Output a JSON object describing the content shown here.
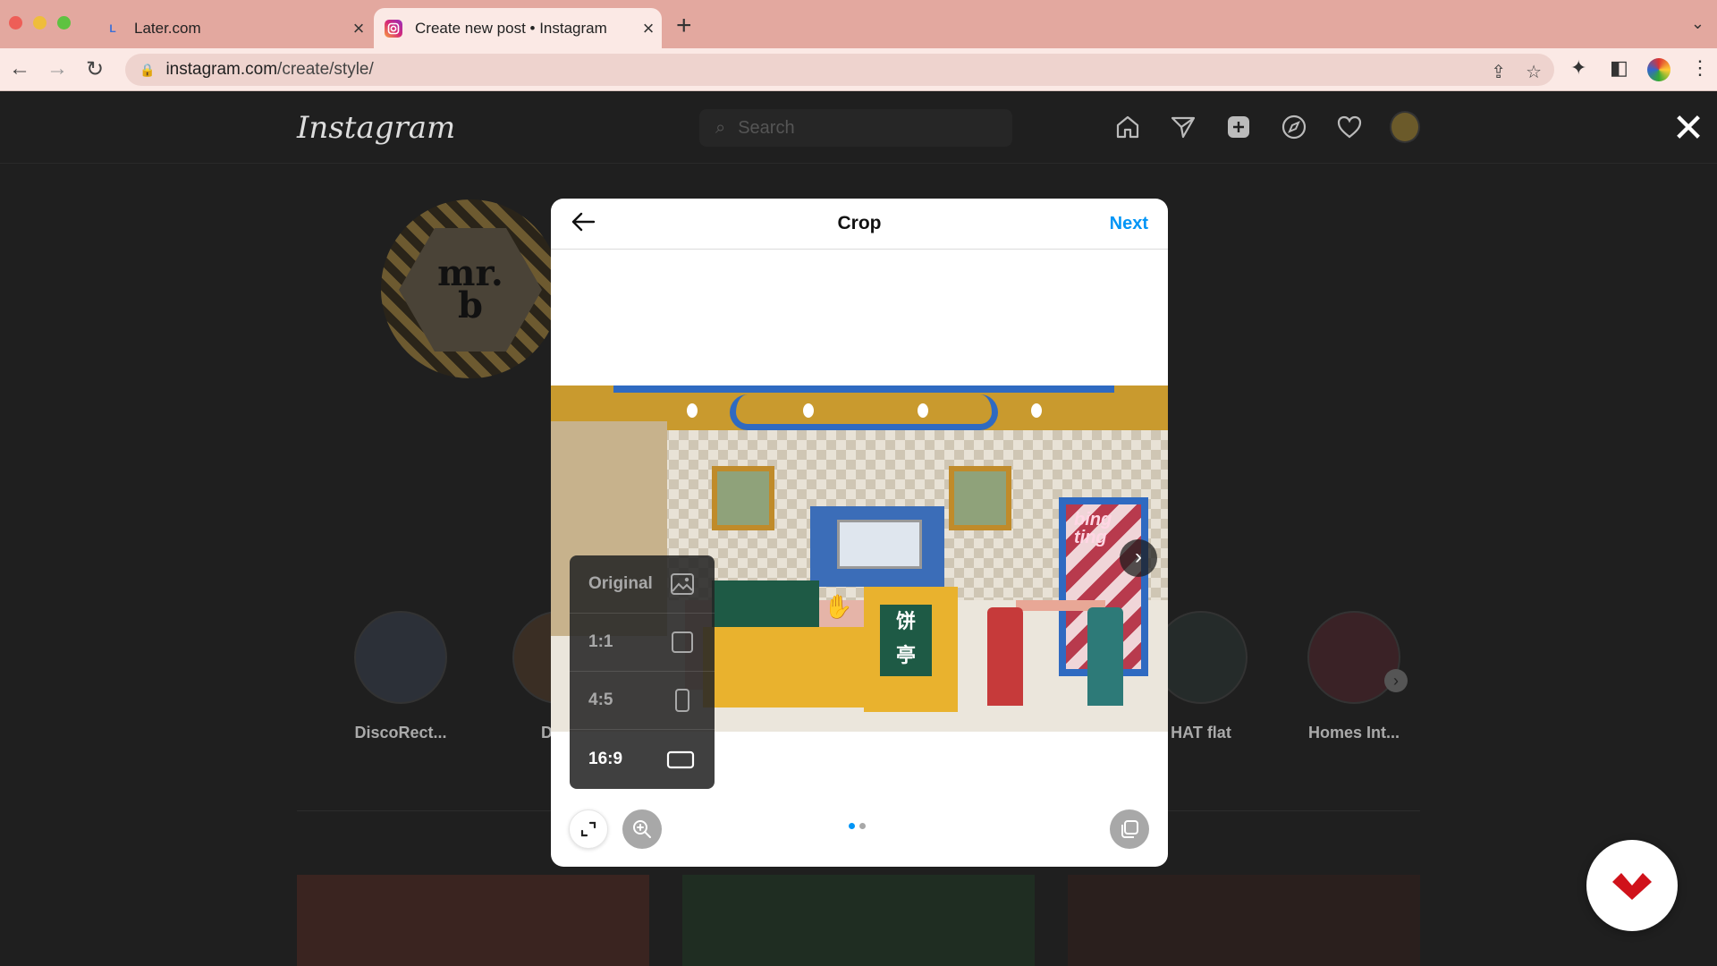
{
  "browser": {
    "tabs": [
      {
        "title": "Later.com",
        "favicon": "later-logo-icon",
        "active": false
      },
      {
        "title": "Create new post • Instagram",
        "favicon": "instagram-icon",
        "active": true
      }
    ],
    "url_host": "instagram.com",
    "url_path": "/create/style/",
    "colors": {
      "tabbar": "#e3a89f",
      "toolbar": "#fbe9e5"
    }
  },
  "instagram": {
    "logo": "Instagram",
    "search_placeholder": "Search",
    "nav_icons": [
      "home-icon",
      "direct-icon",
      "new-post-icon",
      "explore-icon",
      "activity-heart-icon",
      "profile-avatar"
    ],
    "profile_badge": "mr.\nb",
    "highlights": [
      {
        "label": "DiscoRect..."
      },
      {
        "label": "Drea"
      },
      {
        "label": "HAT flat"
      },
      {
        "label": "Homes Int..."
      }
    ]
  },
  "modal": {
    "title": "Crop",
    "next_label": "Next",
    "crop_options": [
      {
        "label": "Original",
        "icon": "image-icon",
        "selected": false
      },
      {
        "label": "1:1",
        "icon": "square-icon",
        "selected": false
      },
      {
        "label": "4:5",
        "icon": "portrait-rect-icon",
        "selected": false
      },
      {
        "label": "16:9",
        "icon": "landscape-rect-icon",
        "selected": true
      }
    ],
    "photo_sign_text": "饼\n亭",
    "photo_neon_text": "bing\nting",
    "carousel": {
      "count": 2,
      "active_index": 0
    },
    "accent_color": "#0095f6"
  }
}
